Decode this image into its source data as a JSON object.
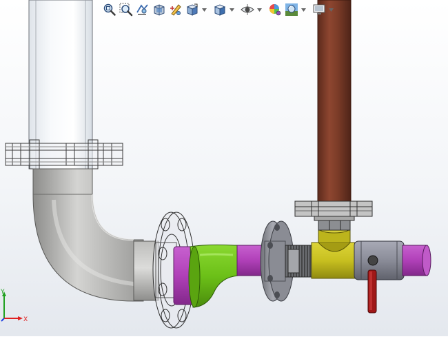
{
  "toolbar": {
    "buttons": [
      {
        "name": "zoom-to-fit-icon",
        "has_dropdown": false
      },
      {
        "name": "zoom-to-area-icon",
        "has_dropdown": false
      },
      {
        "name": "previous-view-icon",
        "has_dropdown": false
      },
      {
        "name": "section-view-icon",
        "has_dropdown": false
      },
      {
        "name": "dynamic-annotation-view-icon",
        "has_dropdown": false
      },
      {
        "name": "view-orientation-icon",
        "has_dropdown": true
      },
      {
        "name": "display-style-icon",
        "has_dropdown": true
      },
      {
        "name": "hide-show-items-icon",
        "has_dropdown": true
      },
      {
        "name": "edit-appearance-icon",
        "has_dropdown": false
      },
      {
        "name": "apply-scene-icon",
        "has_dropdown": true
      },
      {
        "name": "view-settings-icon",
        "has_dropdown": true
      }
    ]
  },
  "triad": {
    "x_label": "X",
    "y_label": "Y",
    "colors": {
      "x": "#e02020",
      "y": "#20a020",
      "z": "#2040e0"
    }
  },
  "model": {
    "part_colors": {
      "glass_pipe": "#eef2f6",
      "steel_elbow": "#b8b8b6",
      "magenta_pipe": "#b040b8",
      "green_reducer": "#6cc018",
      "flange_steel": "#9a9ca4",
      "yellow_tee": "#c8c020",
      "copper_riser": "#7a3a28",
      "valve_body": "#8a8c98",
      "valve_handle": "#a01818"
    }
  }
}
